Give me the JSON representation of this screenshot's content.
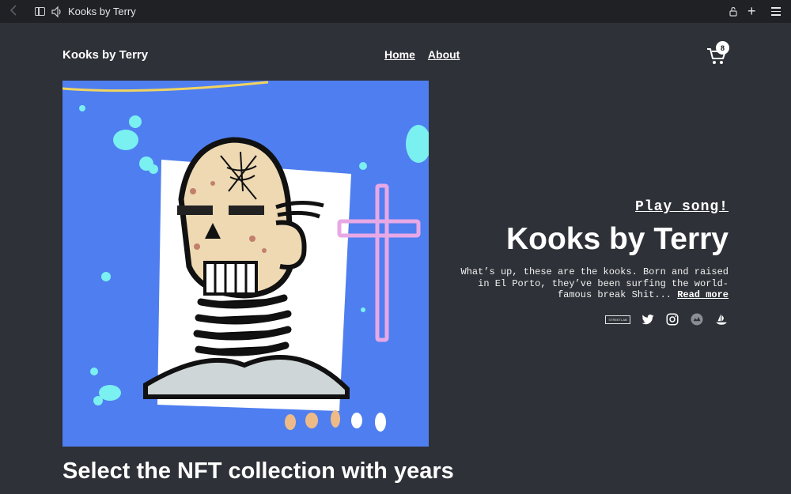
{
  "browser": {
    "tab_title": "Kooks by Terry"
  },
  "header": {
    "brand": "Kooks by Terry",
    "nav": [
      {
        "label": "Home"
      },
      {
        "label": "About"
      }
    ],
    "cart_count": "8"
  },
  "hero": {
    "play_label": "Play song!",
    "title": "Kooks by Terry",
    "description": "What’s up, these are the kooks. Born and raised in El Porto, they’ve been surfing the world-famous break Shit...",
    "read_more": "Read more",
    "socials": [
      {
        "icon": "streetlab-icon",
        "label": "STREETLAB"
      },
      {
        "icon": "twitter-icon"
      },
      {
        "icon": "instagram-icon"
      },
      {
        "icon": "marketplace-icon"
      },
      {
        "icon": "opensea-icon"
      }
    ]
  },
  "section": {
    "title": "Select the NFT collection with years"
  },
  "colors": {
    "background": "#2e3137",
    "chrome": "#1f2125",
    "art_background": "#4f7ef0",
    "accent_pink": "#e7a8e6",
    "accent_cyan": "#7af0f0"
  }
}
